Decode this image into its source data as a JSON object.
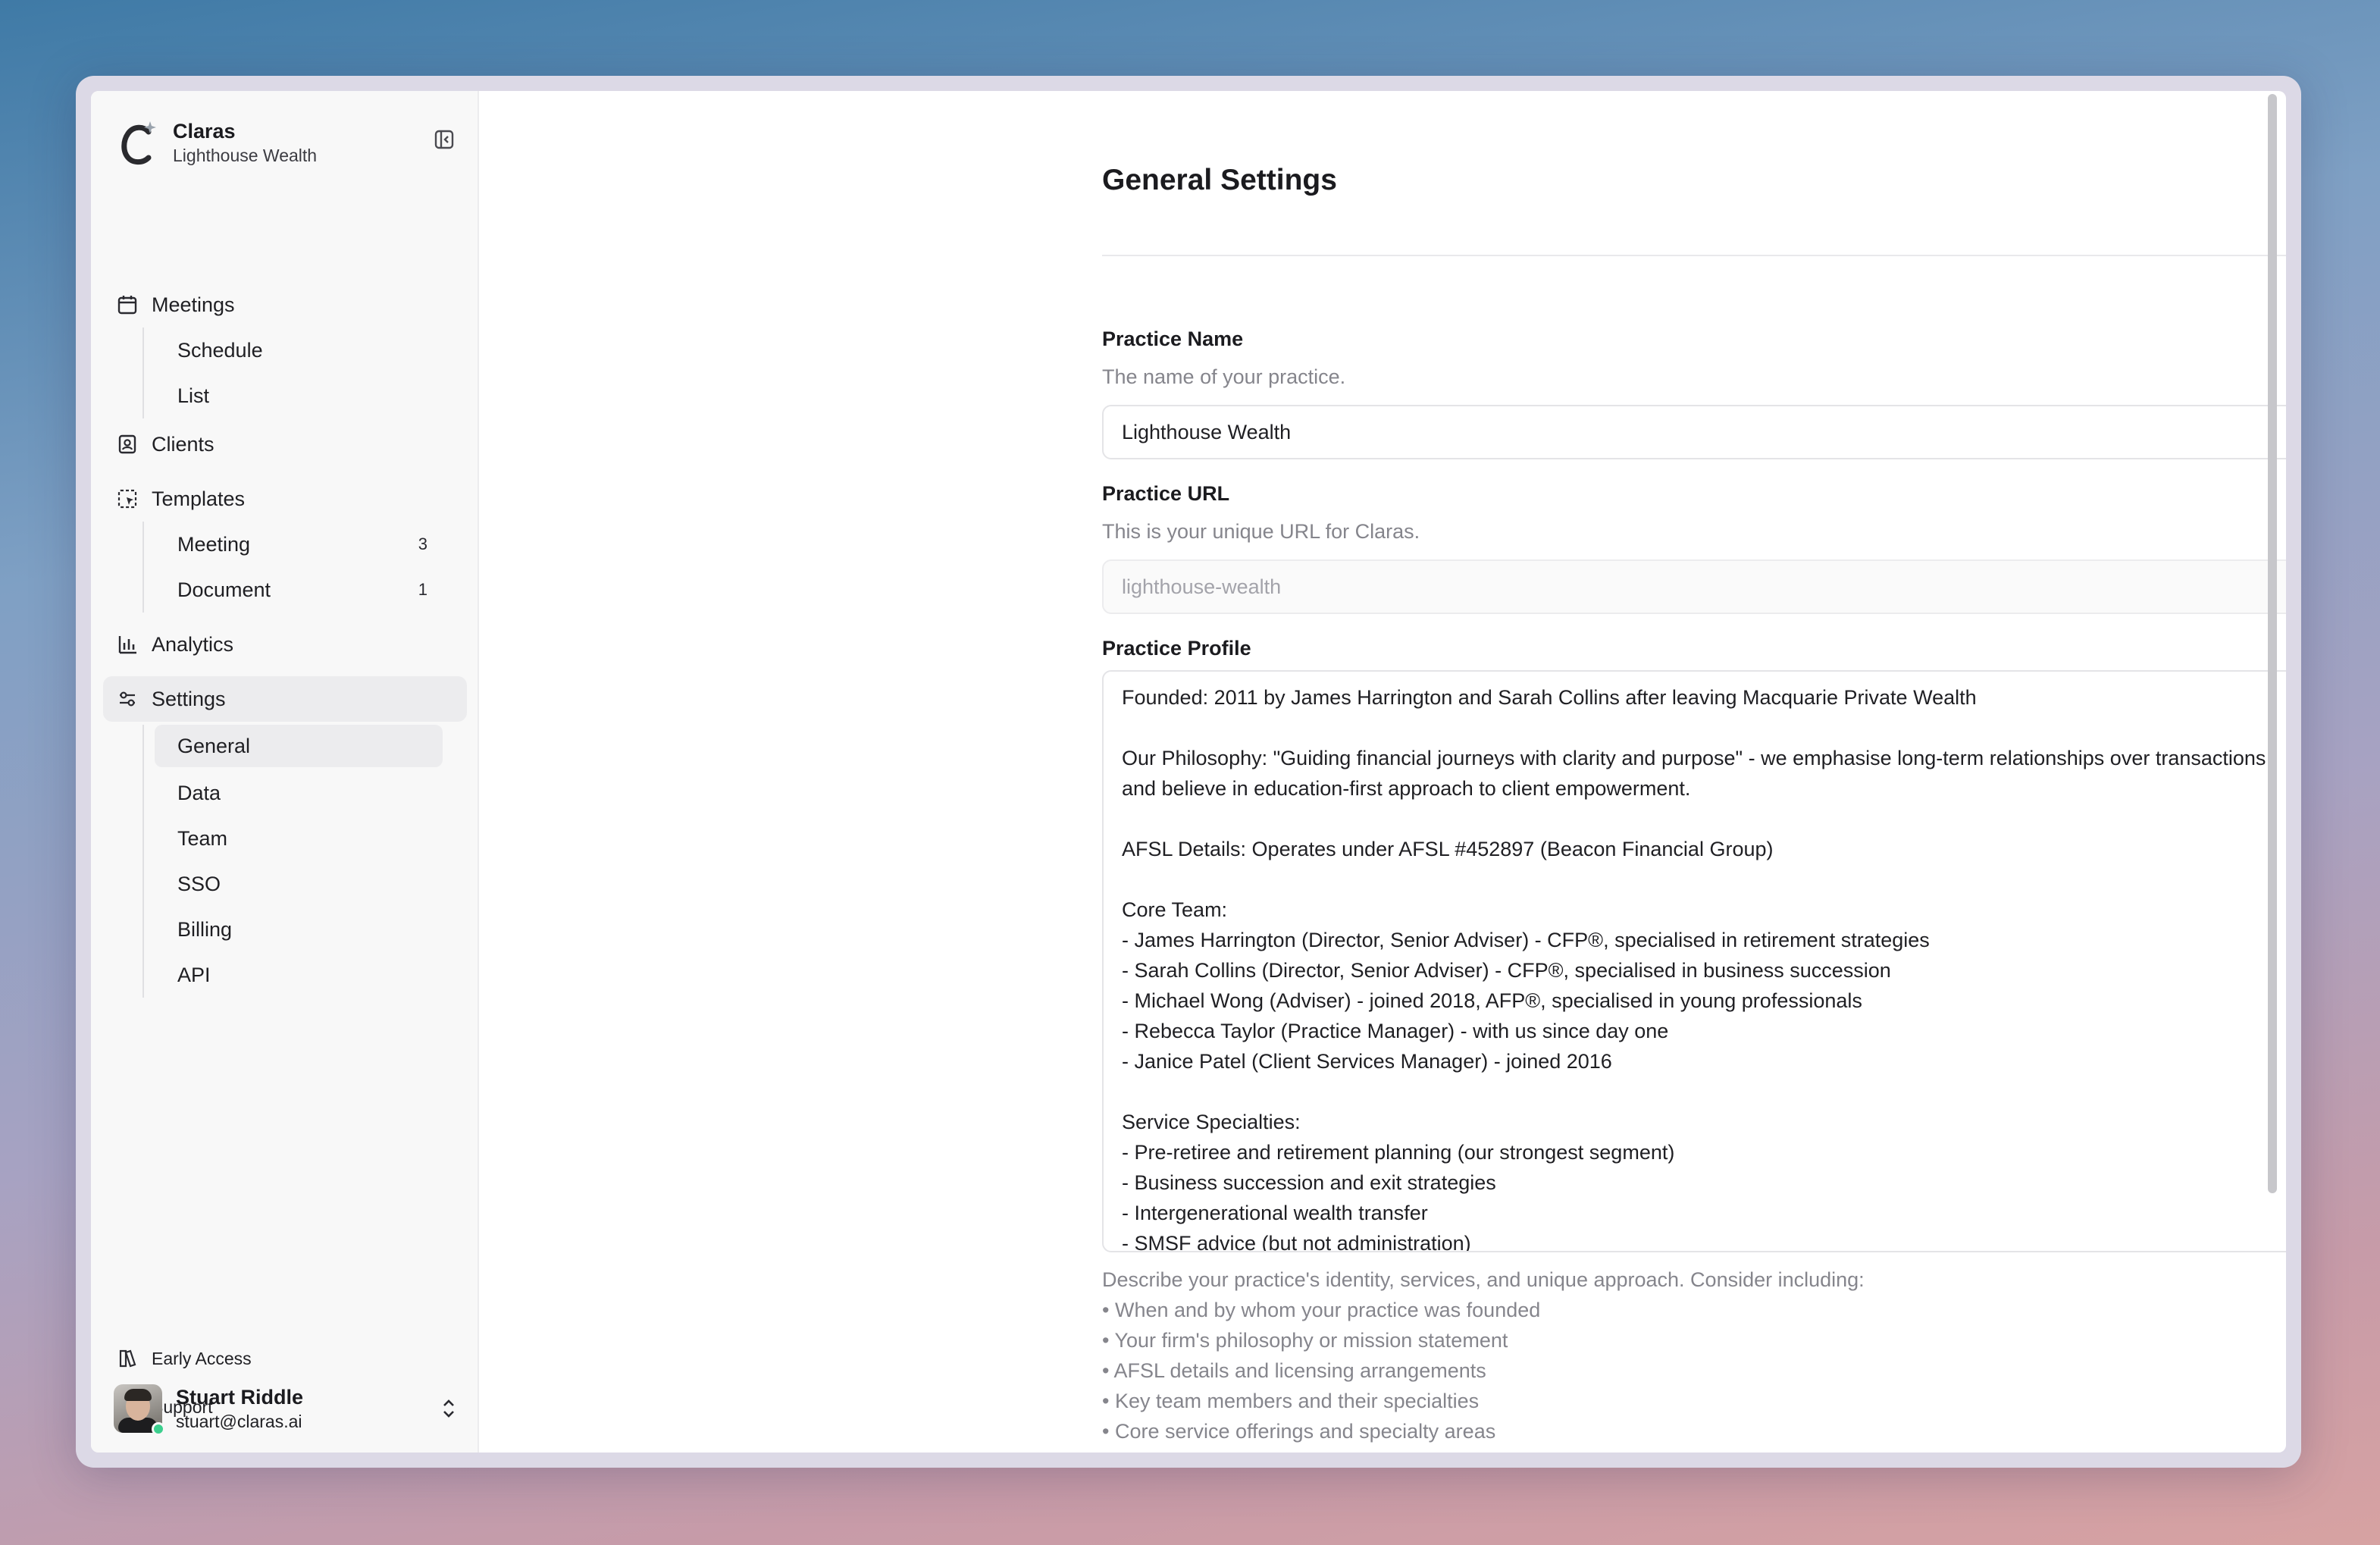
{
  "brand": {
    "name": "Claras",
    "org": "Lighthouse Wealth"
  },
  "nav": {
    "meetings": {
      "label": "Meetings",
      "children": [
        "Schedule",
        "List"
      ]
    },
    "clients": {
      "label": "Clients"
    },
    "templates": {
      "label": "Templates",
      "children": [
        {
          "label": "Meeting",
          "count": "3"
        },
        {
          "label": "Document",
          "count": "1"
        }
      ]
    },
    "analytics": {
      "label": "Analytics"
    },
    "settings": {
      "label": "Settings",
      "children": [
        "General",
        "Data",
        "Team",
        "SSO",
        "Billing",
        "API"
      ]
    }
  },
  "footer": {
    "early_access": "Early Access",
    "support": "Support"
  },
  "user": {
    "name": "Stuart Riddle",
    "email": "stuart@claras.ai"
  },
  "page": {
    "title": "General Settings",
    "practice_name": {
      "label": "Practice Name",
      "description": "The name of your practice.",
      "value": "Lighthouse Wealth"
    },
    "practice_url": {
      "label": "Practice URL",
      "description": "This is your unique URL for Claras.",
      "value": "lighthouse-wealth"
    },
    "practice_profile": {
      "label": "Practice Profile",
      "lines": [
        "Founded: 2011 by James Harrington and Sarah Collins after leaving Macquarie Private Wealth",
        "",
        "Our Philosophy: \"Guiding financial journeys with clarity and purpose\" - we emphasise long-term relationships over transactions",
        "and believe in education-first approach to client empowerment.",
        "",
        "AFSL Details: Operates under AFSL #452897 (Beacon Financial Group)",
        "",
        "Core Team:",
        "- James Harrington (Director, Senior Adviser) - CFP®, specialised in retirement strategies",
        "- Sarah Collins (Director, Senior Adviser) - CFP®, specialised in business succession",
        "- Michael Wong (Adviser) - joined 2018, AFP®, specialised in young professionals",
        "- Rebecca Taylor (Practice Manager) - with us since day one",
        "- Janice Patel (Client Services Manager) - joined 2016",
        "",
        "Service Specialties:",
        "- Pre-retiree and retirement planning (our strongest segment)",
        "- Business succession and exit strategies",
        "- Intergenerational wealth transfer",
        "- SMSF advice (but not administration)"
      ],
      "hints": [
        "Describe your practice's identity, services, and unique approach. Consider including:",
        "• When and by whom your practice was founded",
        "• Your firm's philosophy or mission statement",
        "• AFSL details and licensing arrangements",
        "• Key team members and their specialties",
        "• Core service offerings and specialty areas"
      ]
    }
  },
  "icons": {
    "collapse": "sidebar-collapse-icon",
    "meetings": "calendar-icon",
    "clients": "contact-card-icon",
    "templates": "template-select-icon",
    "analytics": "bar-chart-icon",
    "settings": "sliders-icon",
    "early_access": "book-icon",
    "support": "lifebuoy-icon",
    "chat": "chat-bubble-icon"
  }
}
